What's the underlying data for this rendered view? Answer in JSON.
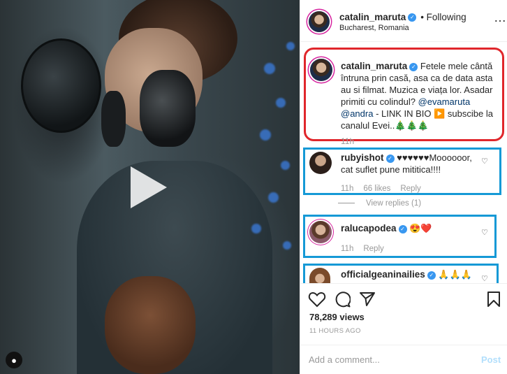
{
  "header": {
    "username": "catalin_maruta",
    "follow_status": "• Following",
    "location": "Bucharest, Romania",
    "more": "…"
  },
  "caption": {
    "username": "catalin_maruta",
    "text_part1": "Fetele mele cântă întruna prin casă, asa ca de data asta au si filmat. Muzica e viața lor. Asadar primiti cu colindul?",
    "mention1": "@evamaruta",
    "mention2": "@andra",
    "text_part2": " - LINK IN BIO ▶️ subscibe la canalul Evei..🎄🎄🎄",
    "time": "11h"
  },
  "comments": [
    {
      "username": "rubyishot",
      "text": "♥♥♥♥♥♥Moooooor, cat suflet pune mititica!!!!",
      "time": "11h",
      "likes": "66 likes",
      "reply": "Reply",
      "view_replies": "View replies (1)"
    },
    {
      "username": "ralucapodea",
      "text": "😍❤️",
      "time": "11h",
      "reply": "Reply"
    },
    {
      "username": "officialgeaninailies",
      "text": "🙏🙏🙏"
    }
  ],
  "stats": {
    "views": "78,289 views",
    "time_ago": "11 HOURS AGO"
  },
  "add_comment": {
    "placeholder": "Add a comment...",
    "post_label": "Post"
  },
  "colors": {
    "caption_highlight": "#e0262b",
    "comment_highlight": "#1599d6",
    "verified": "#3897f0"
  }
}
